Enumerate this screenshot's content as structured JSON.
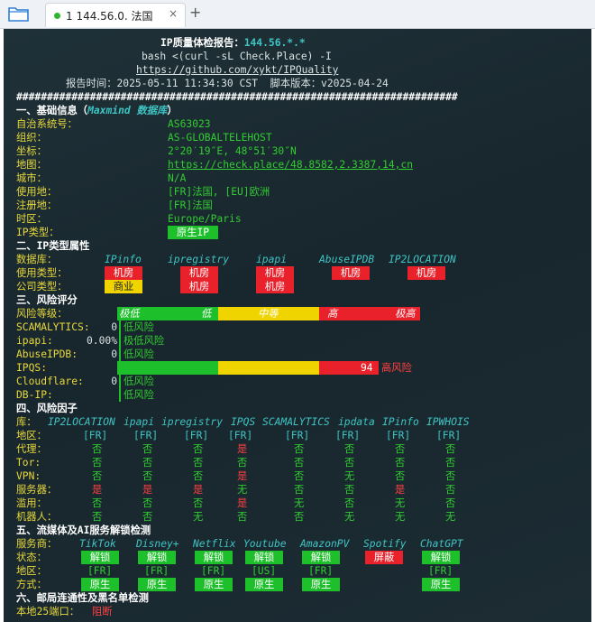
{
  "tab": {
    "title": "1 144.56.0. 法国",
    "close": "×",
    "new": "+"
  },
  "header": {
    "title": "IP质量体检报告：",
    "ip": "144.56.*.*",
    "cmd": "bash <(curl -sL Check.Place) -I",
    "url": "https://github.com/xykt/IPQuality",
    "time_label": "报告时间：",
    "time": "2025-05-11 11:34:30 CST",
    "ver_label": "脚本版本：",
    "ver": "v2025-04-24",
    "sep": "########################################################################"
  },
  "basic": {
    "title": "一、基础信息（",
    "title_src": "Maxmind 数据库",
    "title_end": "）",
    "rows": [
      {
        "label": "自治系统号：",
        "value": "AS63023"
      },
      {
        "label": "组织：",
        "value": "AS-GLOBALTELEHOST"
      },
      {
        "label": "坐标：",
        "value": "2°20′19″E, 48°51′30″N"
      },
      {
        "label": "地图：",
        "value": "https://check.place/48.8582,2.3387,14,cn"
      },
      {
        "label": "城市：",
        "value": "N/A"
      },
      {
        "label": "使用地：",
        "value": "[FR]法国, [EU]欧洲"
      },
      {
        "label": "注册地：",
        "value": "[FR]法国"
      },
      {
        "label": "时区：",
        "value": "Europe/Paris"
      }
    ],
    "iptype_label": "IP类型：",
    "iptype": "原生IP"
  },
  "types": {
    "title": "二、IP类型属性",
    "db_label": "数据库：",
    "dbs": [
      "IPinfo",
      "ipregistry",
      "ipapi",
      "AbuseIPDB",
      "IP2LOCATION"
    ],
    "use_label": "使用类型：",
    "use": [
      "机房",
      "机房",
      "机房",
      "机房",
      "机房"
    ],
    "company_label": "公司类型：",
    "company": [
      "商业",
      "机房",
      "机房"
    ]
  },
  "risk": {
    "title": "三、风险评分",
    "level_label": "风险等级：",
    "levels": [
      "极低",
      "低",
      "中等",
      "高",
      "极高"
    ],
    "rows": [
      {
        "label": "SCAMALYTICS:",
        "score": "0",
        "text": "低风险"
      },
      {
        "label": "ipapi:",
        "score": "0.00%",
        "text": "极低风险"
      },
      {
        "label": "AbuseIPDB:",
        "score": "0",
        "text": "低风险"
      },
      {
        "label": "IPQS:",
        "score": "94",
        "text": "高风险"
      },
      {
        "label": "Cloudflare:",
        "score": "0",
        "text": "低风险"
      },
      {
        "label": "DB-IP:",
        "score": "",
        "text": "低风险"
      }
    ]
  },
  "factors": {
    "title": "四、风险因子",
    "db_label": "库：",
    "dbs": [
      "IP2LOCATION",
      "ipapi",
      "ipregistry",
      "IPQS",
      "SCAMALYTICS",
      "ipdata",
      "IPinfo",
      "IPWHOIS"
    ],
    "rows": [
      {
        "label": "地区：",
        "vals": [
          "[FR]",
          "[FR]",
          "[FR]",
          "[FR]",
          "[FR]",
          "[FR]",
          "[FR]",
          "[FR]"
        ]
      },
      {
        "label": "代理：",
        "vals": [
          "否",
          "否",
          "否",
          "是",
          "否",
          "否",
          "否",
          "否"
        ]
      },
      {
        "label": "Tor:",
        "vals": [
          "否",
          "否",
          "否",
          "否",
          "否",
          "否",
          "否",
          "否"
        ]
      },
      {
        "label": "VPN:",
        "vals": [
          "否",
          "否",
          "否",
          "是",
          "否",
          "无",
          "否",
          "否"
        ]
      },
      {
        "label": "服务器：",
        "vals": [
          "是",
          "是",
          "是",
          "无",
          "否",
          "否",
          "是",
          "否"
        ]
      },
      {
        "label": "滥用：",
        "vals": [
          "否",
          "否",
          "否",
          "是",
          "无",
          "否",
          "无",
          "否"
        ]
      },
      {
        "label": "机器人：",
        "vals": [
          "否",
          "否",
          "无",
          "否",
          "否",
          "无",
          "无",
          "无"
        ]
      }
    ]
  },
  "media": {
    "title": "五、流媒体及AI服务解锁检测",
    "svc_label": "服务商：",
    "services": [
      "TikTok",
      "Disney+",
      "Netflix",
      "Youtube",
      "AmazonPV",
      "Spotify",
      "ChatGPT"
    ],
    "status_label": "状态：",
    "status": [
      "解锁",
      "解锁",
      "解锁",
      "解锁",
      "解锁",
      "屏蔽",
      "解锁"
    ],
    "region_label": "地区：",
    "regions": [
      "[FR]",
      "[FR]",
      "[FR]",
      "[US]",
      "[FR]",
      "",
      "[FR]"
    ],
    "mode_label": "方式：",
    "modes": [
      "原生",
      "原生",
      "原生",
      "原生",
      "原生",
      "",
      "原生"
    ]
  },
  "mail": {
    "title": "六、邮局连通性及黑名单检测",
    "port_label": "本地25端口：",
    "port": "阻断"
  },
  "colors": {
    "accent_green": "#1dbf2a",
    "accent_red": "#e8212b",
    "accent_yellow": "#f0d400",
    "terminal_bg": "#1b2b31"
  }
}
